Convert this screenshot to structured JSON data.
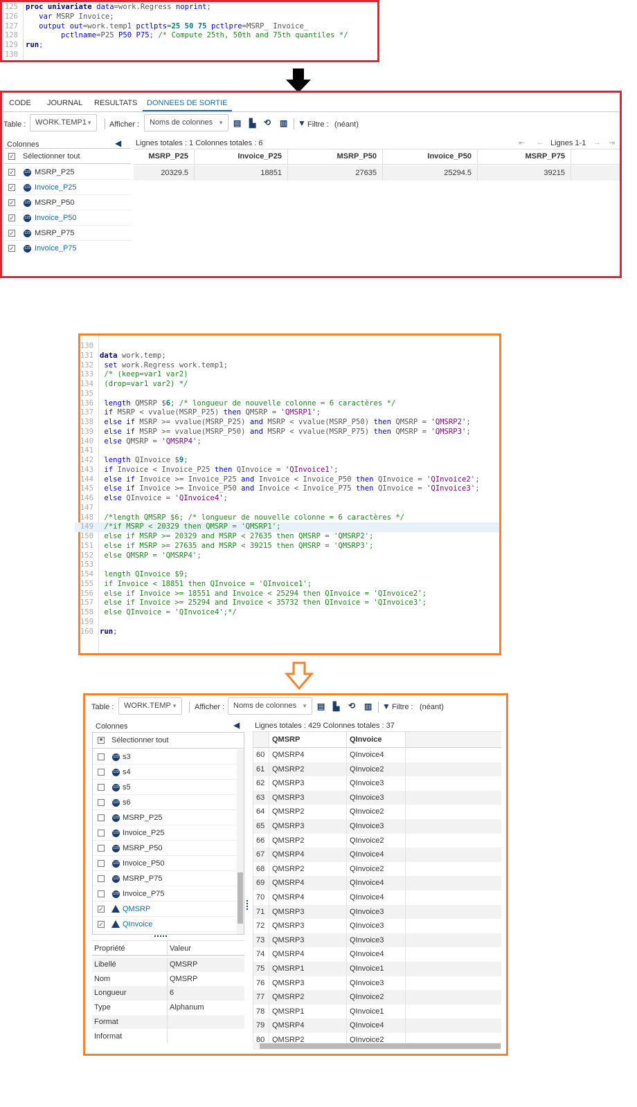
{
  "code1": {
    "start": 125,
    "lines": [
      [
        [
          "kd",
          "proc univariate"
        ],
        [
          "p",
          " "
        ],
        [
          "kw",
          "data"
        ],
        [
          "p",
          "=work.Regress "
        ],
        [
          "kw",
          "noprint"
        ],
        [
          "p",
          ";"
        ]
      ],
      [
        [
          "p",
          "   "
        ],
        [
          "kw",
          "var"
        ],
        [
          "p",
          " MSRP Invoice;"
        ]
      ],
      [
        [
          "p",
          "   "
        ],
        [
          "kw",
          "output out"
        ],
        [
          "p",
          "=work.temp1 "
        ],
        [
          "kw",
          "pctlpts"
        ],
        [
          "p",
          "="
        ],
        [
          "num",
          "25 50 75"
        ],
        [
          "p",
          " "
        ],
        [
          "kw",
          "pctlpre"
        ],
        [
          "p",
          "=MSRP_ Invoice_"
        ]
      ],
      [
        [
          "p",
          "        "
        ],
        [
          "kw",
          "pctlname"
        ],
        [
          "p",
          "=P25 "
        ],
        [
          "kw",
          "P50 P75"
        ],
        [
          "p",
          "; "
        ],
        [
          "cm",
          "/* Compute 25th, 50th and 75th quantiles */"
        ]
      ],
      [
        [
          "kd",
          "run"
        ],
        [
          "p",
          ";"
        ]
      ],
      []
    ]
  },
  "panel1": {
    "tabs": [
      "CODE",
      "JOURNAL",
      "RESULTATS",
      "DONNEES DE SORTIE"
    ],
    "active_tab": 3,
    "table_label": "Table :",
    "table_value": "WORK.TEMP1",
    "afficher_label": "Afficher :",
    "afficher_value": "Noms de colonnes",
    "filtre_label": "Filtre :",
    "filtre_value": "(néant)",
    "colonnes_label": "Colonnes",
    "select_all": "Sélectionner tout",
    "columns": [
      {
        "name": "MSRP_P25",
        "checked": true
      },
      {
        "name": "Invoice_P25",
        "checked": true
      },
      {
        "name": "MSRP_P50",
        "checked": true
      },
      {
        "name": "Invoice_P50",
        "checked": true
      },
      {
        "name": "MSRP_P75",
        "checked": true
      },
      {
        "name": "Invoice_P75",
        "checked": true
      }
    ],
    "info": "Lignes totales : 1   Colonnes totales : 6",
    "pager": "Lignes 1-1",
    "headers": [
      "MSRP_P25",
      "Invoice_P25",
      "MSRP_P50",
      "Invoice_P50",
      "MSRP_P75"
    ],
    "rows": [
      [
        "20329.5",
        "18851",
        "27635",
        "25294.5",
        "39215"
      ]
    ]
  },
  "code2": {
    "start": 130,
    "highlight": 149,
    "lines": [
      [],
      [
        [
          "kd",
          "data"
        ],
        [
          "p",
          " work.temp;"
        ]
      ],
      [
        [
          "p",
          " "
        ],
        [
          "kw",
          "set"
        ],
        [
          "p",
          " work.Regress work.temp1;"
        ]
      ],
      [
        [
          "p",
          " "
        ],
        [
          "cm",
          "/* (keep=var1 var2)"
        ]
      ],
      [
        [
          "cm",
          " (drop=var1 var2) */"
        ]
      ],
      [],
      [
        [
          "p",
          " "
        ],
        [
          "kw",
          "length"
        ],
        [
          "p",
          " QMSRP $"
        ],
        [
          "num",
          "6"
        ],
        [
          "p",
          "; "
        ],
        [
          "cm",
          "/* longueur de nouvelle colonne = 6 caractères */"
        ]
      ],
      [
        [
          "p",
          " "
        ],
        [
          "kw",
          "if"
        ],
        [
          "p",
          " MSRP < vvalue(MSRP_P25) "
        ],
        [
          "kw",
          "then"
        ],
        [
          "p",
          " QMSRP = "
        ],
        [
          "str",
          "'QMSRP1'"
        ],
        [
          "p",
          ";"
        ]
      ],
      [
        [
          "p",
          " "
        ],
        [
          "kw",
          "else if"
        ],
        [
          "p",
          " MSRP >= vvalue(MSRP_P25) "
        ],
        [
          "kw",
          "and"
        ],
        [
          "p",
          " MSRP < vvalue(MSRP_P50) "
        ],
        [
          "kw",
          "then"
        ],
        [
          "p",
          " QMSRP = "
        ],
        [
          "str",
          "'QMSRP2'"
        ],
        [
          "p",
          ";"
        ]
      ],
      [
        [
          "p",
          " "
        ],
        [
          "kw",
          "else if"
        ],
        [
          "p",
          " MSRP >= vvalue(MSRP_P50) "
        ],
        [
          "kw",
          "and"
        ],
        [
          "p",
          " MSRP < vvalue(MSRP_P75) "
        ],
        [
          "kw",
          "then"
        ],
        [
          "p",
          " QMSRP = "
        ],
        [
          "str",
          "'QMSRP3'"
        ],
        [
          "p",
          ";"
        ]
      ],
      [
        [
          "p",
          " "
        ],
        [
          "kw",
          "else"
        ],
        [
          "p",
          " QMSRP = "
        ],
        [
          "str",
          "'QMSRP4'"
        ],
        [
          "p",
          ";"
        ]
      ],
      [],
      [
        [
          "p",
          " "
        ],
        [
          "kw",
          "length"
        ],
        [
          "p",
          " QInvoice $"
        ],
        [
          "num",
          "9"
        ],
        [
          "p",
          ";"
        ]
      ],
      [
        [
          "p",
          " "
        ],
        [
          "kw",
          "if"
        ],
        [
          "p",
          " Invoice < Invoice_P25 "
        ],
        [
          "kw",
          "then"
        ],
        [
          "p",
          " QInvoice = "
        ],
        [
          "str",
          "'QInvoice1'"
        ],
        [
          "p",
          ";"
        ]
      ],
      [
        [
          "p",
          " "
        ],
        [
          "kw",
          "else if"
        ],
        [
          "p",
          " Invoice >= Invoice_P25 "
        ],
        [
          "kw",
          "and"
        ],
        [
          "p",
          " Invoice < Invoice_P50 "
        ],
        [
          "kw",
          "then"
        ],
        [
          "p",
          " QInvoice = "
        ],
        [
          "str",
          "'QInvoice2'"
        ],
        [
          "p",
          ";"
        ]
      ],
      [
        [
          "p",
          " "
        ],
        [
          "kw",
          "else if"
        ],
        [
          "p",
          " Invoice >= Invoice_P50 "
        ],
        [
          "kw",
          "and"
        ],
        [
          "p",
          " Invoice < Invoice_P75 "
        ],
        [
          "kw",
          "then"
        ],
        [
          "p",
          " QInvoice = "
        ],
        [
          "str",
          "'QInvoice3'"
        ],
        [
          "p",
          ";"
        ]
      ],
      [
        [
          "p",
          " "
        ],
        [
          "kw",
          "else"
        ],
        [
          "p",
          " QInvoice = "
        ],
        [
          "str",
          "'QInvoice4'"
        ],
        [
          "p",
          ";"
        ]
      ],
      [],
      [
        [
          "cm",
          " /*length QMSRP $6; /* longueur de nouvelle colonne = 6 caractères */"
        ]
      ],
      [
        [
          "cm",
          " /*if MSRP < 20329 then QMSRP = 'QMSRP1';"
        ]
      ],
      [
        [
          "cm",
          " else if MSRP >= 20329 and MSRP < 27635 then QMSRP = 'QMSRP2';"
        ]
      ],
      [
        [
          "cm",
          " else if MSRP >= 27635 and MSRP < 39215 then QMSRP = 'QMSRP3';"
        ]
      ],
      [
        [
          "cm",
          " else QMSRP = 'QMSRP4';"
        ]
      ],
      [],
      [
        [
          "cm",
          " length QInvoice $9;"
        ]
      ],
      [
        [
          "cm",
          " if Invoice < 18851 then QInvoice = 'QInvoice1';"
        ]
      ],
      [
        [
          "cm",
          " else if Invoice >= 18551 and Invoice < 25294 then QInvoice = 'QInvoice2';"
        ]
      ],
      [
        [
          "cm",
          " else if Invoice >= 25294 and Invoice < 35732 then QInvoice = 'QInvoice3';"
        ]
      ],
      [
        [
          "cm",
          " else QInvoice = 'QInvoice4';*/"
        ]
      ],
      [],
      [
        [
          "kd",
          "run"
        ],
        [
          "p",
          ";"
        ]
      ]
    ]
  },
  "panel2": {
    "table_label": "Table :",
    "table_value": "WORK.TEMP",
    "afficher_label": "Afficher :",
    "afficher_value": "Noms de colonnes",
    "filtre_label": "Filtre :",
    "filtre_value": "(néant)",
    "colonnes_label": "Colonnes",
    "select_all": "Sélectionner tout",
    "columns": [
      {
        "name": "s3",
        "type": "num",
        "checked": false
      },
      {
        "name": "s4",
        "type": "num",
        "checked": false
      },
      {
        "name": "s5",
        "type": "num",
        "checked": false
      },
      {
        "name": "s6",
        "type": "num",
        "checked": false
      },
      {
        "name": "MSRP_P25",
        "type": "num",
        "checked": false
      },
      {
        "name": "Invoice_P25",
        "type": "num",
        "checked": false
      },
      {
        "name": "MSRP_P50",
        "type": "num",
        "checked": false
      },
      {
        "name": "Invoice_P50",
        "type": "num",
        "checked": false
      },
      {
        "name": "MSRP_P75",
        "type": "num",
        "checked": false
      },
      {
        "name": "Invoice_P75",
        "type": "num",
        "checked": false
      },
      {
        "name": "QMSRP",
        "type": "char",
        "checked": true
      },
      {
        "name": "QInvoice",
        "type": "char",
        "checked": true
      }
    ],
    "props_headers": [
      "Propriété",
      "Valeur"
    ],
    "props": [
      [
        "Libellé",
        "QMSRP"
      ],
      [
        "Nom",
        "QMSRP"
      ],
      [
        "Longueur",
        "6"
      ],
      [
        "Type",
        "Alphanum"
      ],
      [
        "Format",
        ""
      ],
      [
        "Informat",
        ""
      ]
    ],
    "info": "Lignes totales : 429   Colonnes totales : 37",
    "headers": [
      "QMSRP",
      "QInvoice"
    ],
    "rows": [
      [
        "60",
        "QMSRP4",
        "QInvoice4"
      ],
      [
        "61",
        "QMSRP2",
        "QInvoice2"
      ],
      [
        "62",
        "QMSRP3",
        "QInvoice3"
      ],
      [
        "63",
        "QMSRP3",
        "QInvoice3"
      ],
      [
        "64",
        "QMSRP2",
        "QInvoice2"
      ],
      [
        "65",
        "QMSRP3",
        "QInvoice3"
      ],
      [
        "66",
        "QMSRP2",
        "QInvoice2"
      ],
      [
        "67",
        "QMSRP4",
        "QInvoice4"
      ],
      [
        "68",
        "QMSRP2",
        "QInvoice2"
      ],
      [
        "69",
        "QMSRP4",
        "QInvoice4"
      ],
      [
        "70",
        "QMSRP4",
        "QInvoice4"
      ],
      [
        "71",
        "QMSRP3",
        "QInvoice3"
      ],
      [
        "72",
        "QMSRP3",
        "QInvoice3"
      ],
      [
        "73",
        "QMSRP3",
        "QInvoice3"
      ],
      [
        "74",
        "QMSRP4",
        "QInvoice4"
      ],
      [
        "75",
        "QMSRP1",
        "QInvoice1"
      ],
      [
        "76",
        "QMSRP3",
        "QInvoice3"
      ],
      [
        "77",
        "QMSRP2",
        "QInvoice2"
      ],
      [
        "78",
        "QMSRP1",
        "QInvoice1"
      ],
      [
        "79",
        "QMSRP4",
        "QInvoice4"
      ],
      [
        "80",
        "QMSRP2",
        "QInvoice2"
      ]
    ]
  },
  "colors": {
    "red": "#e8202a",
    "orange": "#f5812a",
    "accent": "#0b6fb0",
    "navy": "#1b3c6b"
  }
}
